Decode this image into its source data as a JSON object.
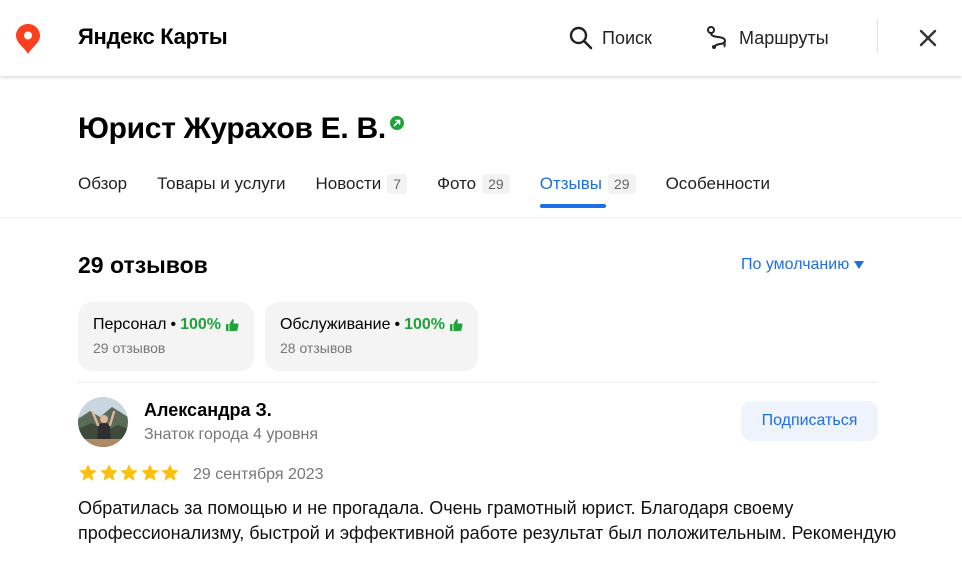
{
  "header": {
    "brand": "Яндекс Карты",
    "search_label": "Поиск",
    "routes_label": "Маршруты"
  },
  "org": {
    "title": "Юрист Журахов Е. В."
  },
  "tabs": [
    {
      "label": "Обзор",
      "count": ""
    },
    {
      "label": "Товары и услуги",
      "count": ""
    },
    {
      "label": "Новости",
      "count": "7"
    },
    {
      "label": "Фото",
      "count": "29"
    },
    {
      "label": "Отзывы",
      "count": "29",
      "active": true
    },
    {
      "label": "Особенности",
      "count": ""
    }
  ],
  "reviews": {
    "count_label": "29 отзывов",
    "sort_label": "По умолчанию",
    "aspects": [
      {
        "name": "Персонал",
        "percent": "100%",
        "sub": "29 отзывов"
      },
      {
        "name": "Обслуживание",
        "percent": "100%",
        "sub": "28 отзывов"
      }
    ],
    "items": [
      {
        "author": "Александра З.",
        "level": "Знаток города 4 уровня",
        "subscribe_label": "Подписаться",
        "rating": 5,
        "date": "29 сентября 2023",
        "text": "Обратилась за помощью и не прогадала. Очень грамотный юрист. Благодаря своему профессионализму, быстрой и эффективной работе результат был положительным. Рекомендую"
      }
    ]
  },
  "colors": {
    "accent": "#1e6fe6",
    "positive": "#1da339",
    "star": "#fcc10f",
    "logo_red": "#fc3f1d"
  }
}
